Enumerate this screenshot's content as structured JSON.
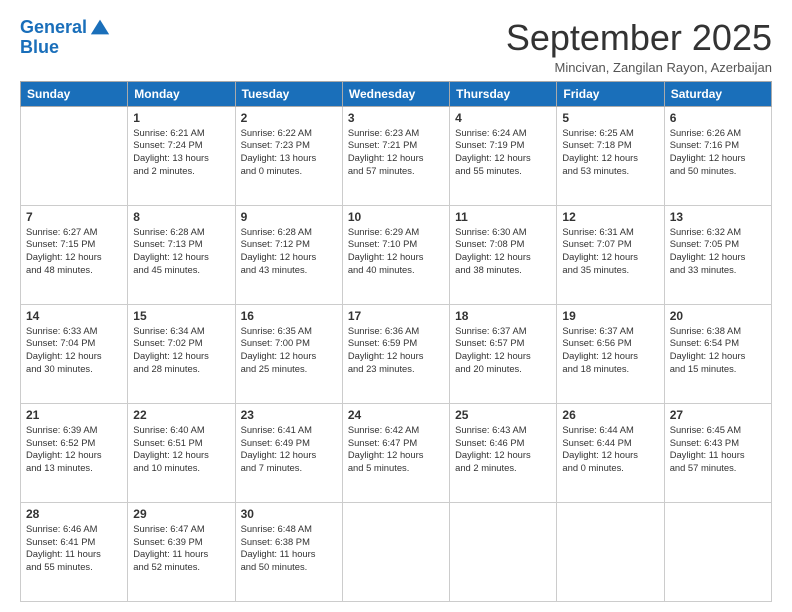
{
  "logo": {
    "line1": "General",
    "line2": "Blue"
  },
  "title": "September 2025",
  "subtitle": "Mincivan, Zangilan Rayon, Azerbaijan",
  "headers": [
    "Sunday",
    "Monday",
    "Tuesday",
    "Wednesday",
    "Thursday",
    "Friday",
    "Saturday"
  ],
  "weeks": [
    [
      {
        "day": "",
        "lines": []
      },
      {
        "day": "1",
        "lines": [
          "Sunrise: 6:21 AM",
          "Sunset: 7:24 PM",
          "Daylight: 13 hours",
          "and 2 minutes."
        ]
      },
      {
        "day": "2",
        "lines": [
          "Sunrise: 6:22 AM",
          "Sunset: 7:23 PM",
          "Daylight: 13 hours",
          "and 0 minutes."
        ]
      },
      {
        "day": "3",
        "lines": [
          "Sunrise: 6:23 AM",
          "Sunset: 7:21 PM",
          "Daylight: 12 hours",
          "and 57 minutes."
        ]
      },
      {
        "day": "4",
        "lines": [
          "Sunrise: 6:24 AM",
          "Sunset: 7:19 PM",
          "Daylight: 12 hours",
          "and 55 minutes."
        ]
      },
      {
        "day": "5",
        "lines": [
          "Sunrise: 6:25 AM",
          "Sunset: 7:18 PM",
          "Daylight: 12 hours",
          "and 53 minutes."
        ]
      },
      {
        "day": "6",
        "lines": [
          "Sunrise: 6:26 AM",
          "Sunset: 7:16 PM",
          "Daylight: 12 hours",
          "and 50 minutes."
        ]
      }
    ],
    [
      {
        "day": "7",
        "lines": [
          "Sunrise: 6:27 AM",
          "Sunset: 7:15 PM",
          "Daylight: 12 hours",
          "and 48 minutes."
        ]
      },
      {
        "day": "8",
        "lines": [
          "Sunrise: 6:28 AM",
          "Sunset: 7:13 PM",
          "Daylight: 12 hours",
          "and 45 minutes."
        ]
      },
      {
        "day": "9",
        "lines": [
          "Sunrise: 6:28 AM",
          "Sunset: 7:12 PM",
          "Daylight: 12 hours",
          "and 43 minutes."
        ]
      },
      {
        "day": "10",
        "lines": [
          "Sunrise: 6:29 AM",
          "Sunset: 7:10 PM",
          "Daylight: 12 hours",
          "and 40 minutes."
        ]
      },
      {
        "day": "11",
        "lines": [
          "Sunrise: 6:30 AM",
          "Sunset: 7:08 PM",
          "Daylight: 12 hours",
          "and 38 minutes."
        ]
      },
      {
        "day": "12",
        "lines": [
          "Sunrise: 6:31 AM",
          "Sunset: 7:07 PM",
          "Daylight: 12 hours",
          "and 35 minutes."
        ]
      },
      {
        "day": "13",
        "lines": [
          "Sunrise: 6:32 AM",
          "Sunset: 7:05 PM",
          "Daylight: 12 hours",
          "and 33 minutes."
        ]
      }
    ],
    [
      {
        "day": "14",
        "lines": [
          "Sunrise: 6:33 AM",
          "Sunset: 7:04 PM",
          "Daylight: 12 hours",
          "and 30 minutes."
        ]
      },
      {
        "day": "15",
        "lines": [
          "Sunrise: 6:34 AM",
          "Sunset: 7:02 PM",
          "Daylight: 12 hours",
          "and 28 minutes."
        ]
      },
      {
        "day": "16",
        "lines": [
          "Sunrise: 6:35 AM",
          "Sunset: 7:00 PM",
          "Daylight: 12 hours",
          "and 25 minutes."
        ]
      },
      {
        "day": "17",
        "lines": [
          "Sunrise: 6:36 AM",
          "Sunset: 6:59 PM",
          "Daylight: 12 hours",
          "and 23 minutes."
        ]
      },
      {
        "day": "18",
        "lines": [
          "Sunrise: 6:37 AM",
          "Sunset: 6:57 PM",
          "Daylight: 12 hours",
          "and 20 minutes."
        ]
      },
      {
        "day": "19",
        "lines": [
          "Sunrise: 6:37 AM",
          "Sunset: 6:56 PM",
          "Daylight: 12 hours",
          "and 18 minutes."
        ]
      },
      {
        "day": "20",
        "lines": [
          "Sunrise: 6:38 AM",
          "Sunset: 6:54 PM",
          "Daylight: 12 hours",
          "and 15 minutes."
        ]
      }
    ],
    [
      {
        "day": "21",
        "lines": [
          "Sunrise: 6:39 AM",
          "Sunset: 6:52 PM",
          "Daylight: 12 hours",
          "and 13 minutes."
        ]
      },
      {
        "day": "22",
        "lines": [
          "Sunrise: 6:40 AM",
          "Sunset: 6:51 PM",
          "Daylight: 12 hours",
          "and 10 minutes."
        ]
      },
      {
        "day": "23",
        "lines": [
          "Sunrise: 6:41 AM",
          "Sunset: 6:49 PM",
          "Daylight: 12 hours",
          "and 7 minutes."
        ]
      },
      {
        "day": "24",
        "lines": [
          "Sunrise: 6:42 AM",
          "Sunset: 6:47 PM",
          "Daylight: 12 hours",
          "and 5 minutes."
        ]
      },
      {
        "day": "25",
        "lines": [
          "Sunrise: 6:43 AM",
          "Sunset: 6:46 PM",
          "Daylight: 12 hours",
          "and 2 minutes."
        ]
      },
      {
        "day": "26",
        "lines": [
          "Sunrise: 6:44 AM",
          "Sunset: 6:44 PM",
          "Daylight: 12 hours",
          "and 0 minutes."
        ]
      },
      {
        "day": "27",
        "lines": [
          "Sunrise: 6:45 AM",
          "Sunset: 6:43 PM",
          "Daylight: 11 hours",
          "and 57 minutes."
        ]
      }
    ],
    [
      {
        "day": "28",
        "lines": [
          "Sunrise: 6:46 AM",
          "Sunset: 6:41 PM",
          "Daylight: 11 hours",
          "and 55 minutes."
        ]
      },
      {
        "day": "29",
        "lines": [
          "Sunrise: 6:47 AM",
          "Sunset: 6:39 PM",
          "Daylight: 11 hours",
          "and 52 minutes."
        ]
      },
      {
        "day": "30",
        "lines": [
          "Sunrise: 6:48 AM",
          "Sunset: 6:38 PM",
          "Daylight: 11 hours",
          "and 50 minutes."
        ]
      },
      {
        "day": "",
        "lines": []
      },
      {
        "day": "",
        "lines": []
      },
      {
        "day": "",
        "lines": []
      },
      {
        "day": "",
        "lines": []
      }
    ]
  ]
}
